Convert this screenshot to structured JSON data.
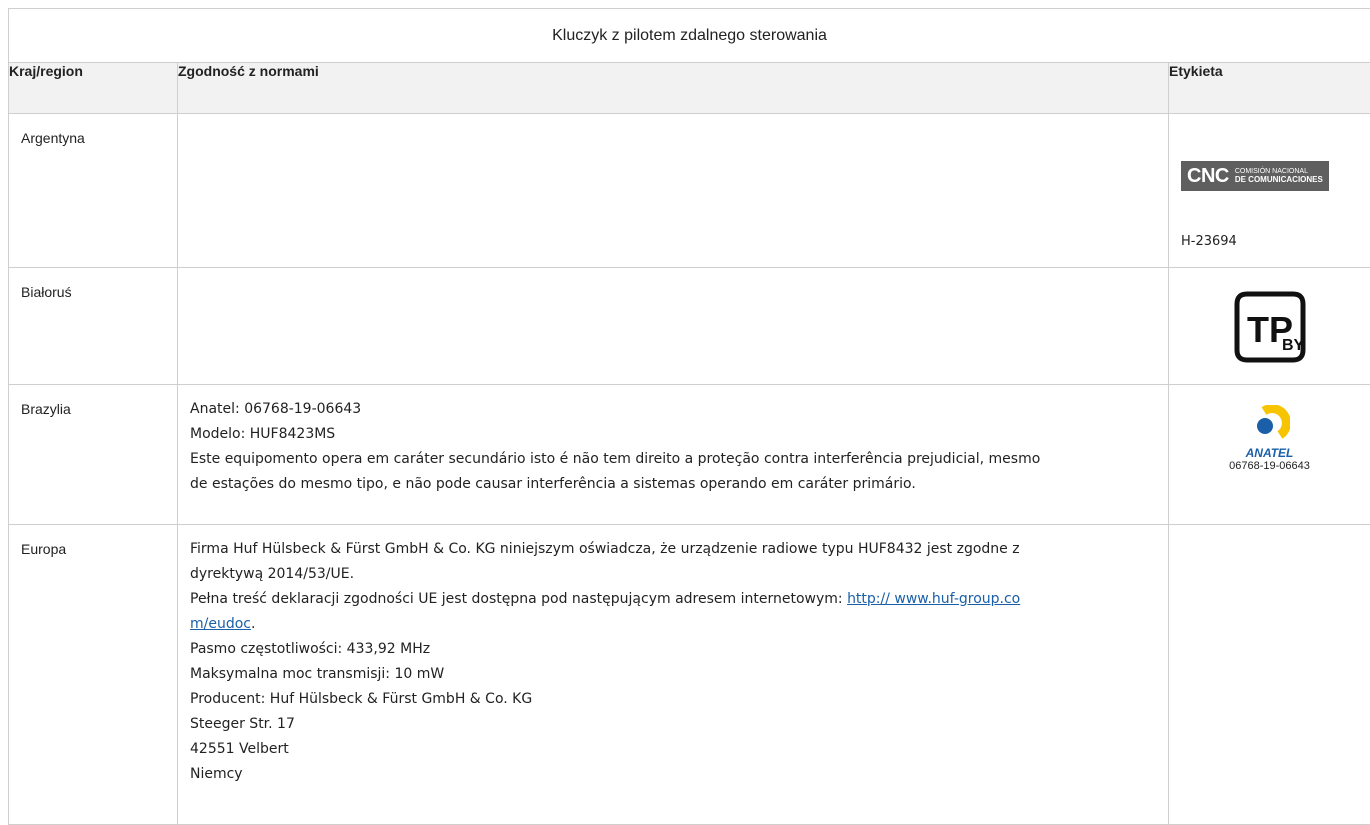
{
  "table": {
    "title": "Kluczyk z pilotem zdalnego sterowania",
    "headers": {
      "country": "Kraj/region",
      "compliance": "Zgodność z normami",
      "label": "Etykieta"
    }
  },
  "rows": {
    "argentina": {
      "country": "Argentyna",
      "label_logo": {
        "letters": "CNC",
        "sub1": "COMISIÓN NACIONAL",
        "sub2": "DE COMUNICACIONES"
      },
      "label_code": "H-23694"
    },
    "belarus": {
      "country": "Białoruś",
      "label_logo": {
        "main": "TP",
        "sub": "BY"
      }
    },
    "brazil": {
      "country": "Brazylia",
      "lines": [
        "Anatel: 06768-19-06643",
        "Modelo: HUF8423MS",
        "Este equipomento opera em caráter secundário isto é não tem direito a proteção contra interferência prejudicial, mesmo",
        "de estações do mesmo tipo, e não pode causar interferência a sistemas operando em caráter primário."
      ],
      "label_logo": {
        "text": "ANATEL",
        "number": "06768-19-06643"
      }
    },
    "europe": {
      "country": "Europa",
      "lines": [
        "Firma Huf Hülsbeck & Fürst GmbH & Co. KG niniejszym oświadcza, że urządzenie radiowe typu HUF8432 jest zgodne z",
        "dyrektywą 2014/53/UE.",
        "Pełna treść deklaracji zgodności UE jest dostępna pod następującym adresem internetowym:",
        "Pasmo częstotliwości: 433,92 MHz",
        "Maksymalna moc transmisji: 10 mW",
        "Producent: Huf Hülsbeck & Fürst GmbH & Co. KG",
        "Steeger Str. 17",
        "42551 Velbert",
        "Niemcy"
      ],
      "link_part1": "http:// www.huf-group.co",
      "link_part2": "m/eudoc",
      "link_suffix": "."
    }
  },
  "colors": {
    "border": "#cfcfcf",
    "header_bg": "#f2f2f2",
    "link": "#1a5fa8",
    "cnc_bg": "#5f5f5f",
    "anatel_blue": "#1a5fa8",
    "anatel_yellow": "#f6c400"
  }
}
